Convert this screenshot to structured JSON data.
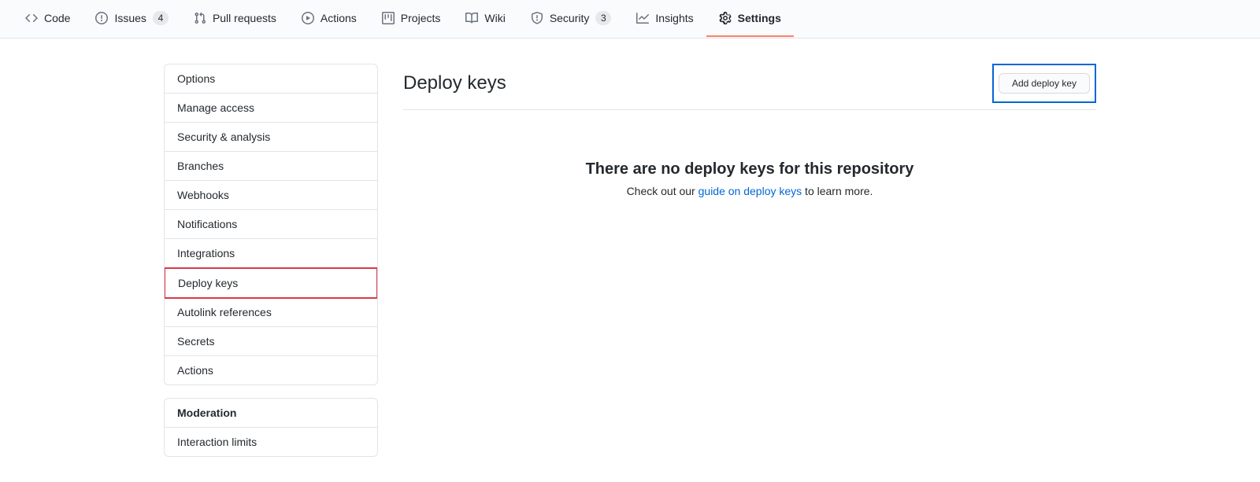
{
  "tabs": {
    "code": "Code",
    "issues": "Issues",
    "issues_count": "4",
    "pulls": "Pull requests",
    "actions": "Actions",
    "projects": "Projects",
    "wiki": "Wiki",
    "security": "Security",
    "security_count": "3",
    "insights": "Insights",
    "settings": "Settings"
  },
  "sidebar": {
    "items": [
      "Options",
      "Manage access",
      "Security & analysis",
      "Branches",
      "Webhooks",
      "Notifications",
      "Integrations",
      "Deploy keys",
      "Autolink references",
      "Secrets",
      "Actions"
    ],
    "moderation_heading": "Moderation",
    "moderation_items": [
      "Interaction limits"
    ]
  },
  "main": {
    "heading": "Deploy keys",
    "add_button": "Add deploy key",
    "empty_heading": "There are no deploy keys for this repository",
    "empty_prefix": "Check out our ",
    "empty_link": "guide on deploy keys",
    "empty_suffix": " to learn more."
  }
}
